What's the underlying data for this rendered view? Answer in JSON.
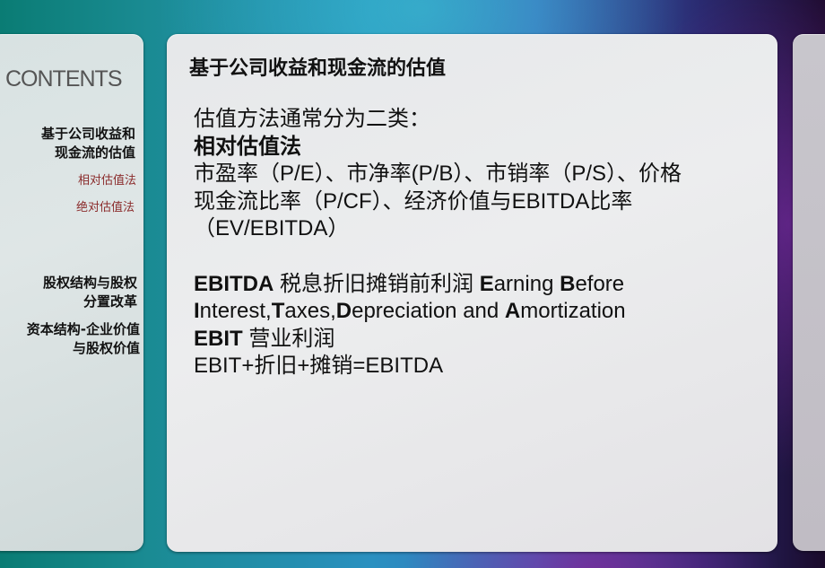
{
  "sidebar": {
    "heading": "CONTENTS",
    "items": [
      {
        "label": "基于公司收益和现金流的估值",
        "line1": "基于公司收益和",
        "line2": "现金流的估值"
      },
      {
        "label": "相对估值法"
      },
      {
        "label": "绝对估值法"
      },
      {
        "label": "股权结构与股权分置改革",
        "line1": "股权结构与股权",
        "line2": "分置改革"
      },
      {
        "label": "资本结构-企业价值与股权价值",
        "line1": "资本结构-企业价值",
        "line2": "与股权价值"
      }
    ]
  },
  "main": {
    "title": "基于公司收益和现金流的估值",
    "intro": "估值方法通常分为二类：",
    "method_heading": "相对估值法",
    "ratios_line1": "市盈率（P/E）、市净率(P/B）、市销率（P/S）、价格",
    "ratios_line2": "现金流比率（P/CF）、经济价值与EBITDA比率",
    "ratios_line3": "（EV/EBITDA）",
    "ebitda_term": "EBITDA",
    "ebitda_cn": " 税息折旧摊销前利润 ",
    "ebitda_en": [
      {
        "b": "E",
        "t": "arning "
      },
      {
        "b": "B",
        "t": "efore"
      }
    ],
    "ebitda_en2": [
      {
        "b": "I",
        "t": "nterest,"
      },
      {
        "b": "T",
        "t": "axes,"
      },
      {
        "b": "D",
        "t": "epreciation and "
      },
      {
        "b": "A",
        "t": "mortization"
      }
    ],
    "ebit_term": "EBIT",
    "ebit_cn": " 营业利润",
    "formula": "EBIT+折旧+摊销=EBITDA"
  }
}
